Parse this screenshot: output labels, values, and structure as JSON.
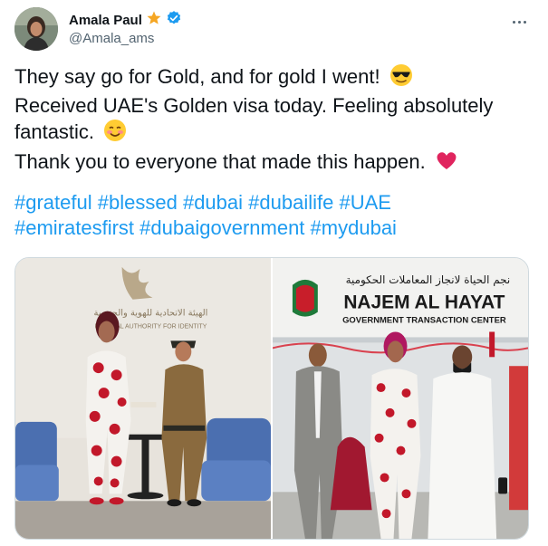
{
  "tweet": {
    "author": {
      "display_name": "Amala Paul",
      "badge_icon": "star-icon",
      "verified_icon": "verified-badge-icon",
      "handle": "@Amala_ams"
    },
    "more_icon": "more-options-icon",
    "text_lines": [
      "They say go for Gold, and for gold I went! ",
      "Received UAE's Golden visa today. Feeling absolutely",
      "fantastic. ",
      "Thank you to everyone that made this happen. "
    ],
    "emojis": [
      "sunglasses-face-emoji",
      "smiling-face-emoji",
      "red-heart-emoji"
    ],
    "hashtags": [
      "#grateful",
      "#blessed",
      "#dubai",
      "#dubailife",
      "#UAE",
      "#emiratesfirst",
      "#dubaigovernment",
      "#mydubai"
    ],
    "media": {
      "photo1": {
        "sign_arabic": "الهيئة الاتحادية للهوية والجنسية",
        "sign_english": "FEDERAL AUTHORITY FOR IDENTITY"
      },
      "photo2": {
        "sign_arabic": "نجم الحياة لانجاز المعاملات الحكومية",
        "sign_title": "NAJEM AL HAYAT",
        "sign_sub": "GOVERNMENT TRANSACTION CENTER"
      }
    },
    "colors": {
      "link": "#1d9bf0",
      "verified": "#1d9bf0",
      "star": "#f5a623",
      "heart": "#e0245e"
    }
  }
}
